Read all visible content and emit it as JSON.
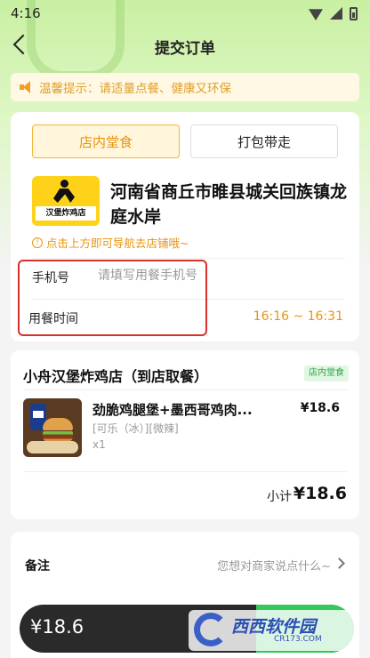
{
  "status": {
    "time": "4:16"
  },
  "nav": {
    "title": "提交订单"
  },
  "notice": {
    "text": "温馨提示：请适量点餐、健康又环保"
  },
  "store": {
    "tabs": [
      {
        "label": "店内堂食",
        "selected": true
      },
      {
        "label": "打包带走",
        "selected": false
      }
    ],
    "logo_text": "汉堡炸鸡店",
    "address": "河南省商丘市睢县城关回族镇龙庭水岸",
    "nav_hint": "点击上方即可导航去店铺哦~",
    "phone_label": "手机号",
    "phone_placeholder": "请填写用餐手机号",
    "time_label": "用餐时间",
    "time_value": "16:16 ~ 16:31"
  },
  "order": {
    "shop_name": "小舟汉堡炸鸡店（到店取餐）",
    "badge": "店内堂食",
    "items": [
      {
        "name": "劲脆鸡腿堡+墨西哥鸡肉...",
        "spec": "[可乐（冰）][微辣]",
        "qty": "x1",
        "price": "¥18.6"
      }
    ],
    "subtotal_label": "小计",
    "subtotal_value": "¥18.6"
  },
  "remarks": {
    "label": "备注",
    "hint": "您想对商家说点什么~"
  },
  "bottom": {
    "total": "¥18.6"
  },
  "watermark": {
    "title": "西西软件园",
    "sub": "CR173.COM"
  },
  "colors": {
    "accent": "#e8940f",
    "green": "#35c85a",
    "highlight": "#d8312b"
  }
}
